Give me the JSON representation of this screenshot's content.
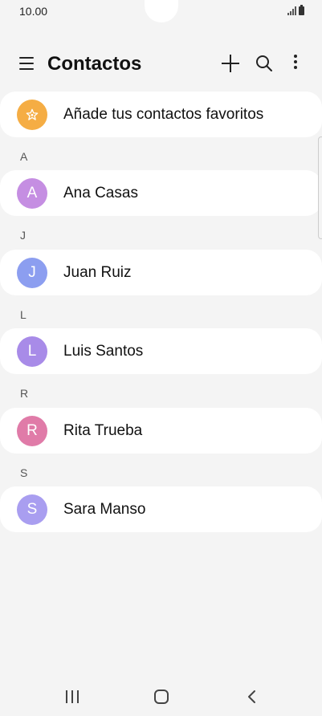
{
  "status_bar": {
    "time": "10.00",
    "icons": [
      "signal-icon",
      "battery-icon"
    ]
  },
  "app_bar": {
    "title": "Contactos",
    "icons": [
      "menu-icon",
      "add-icon",
      "search-icon",
      "more-icon"
    ]
  },
  "favorites": {
    "label": "Añade tus contactos favoritos",
    "icon": "star-icon",
    "color": "#f5ad44"
  },
  "sections": [
    {
      "letter": "A",
      "contact": {
        "initial": "A",
        "name": "Ana Casas",
        "color": "#c58ee2"
      }
    },
    {
      "letter": "J",
      "contact": {
        "initial": "J",
        "name": "Juan Ruiz",
        "color": "#8c9ef0"
      }
    },
    {
      "letter": "L",
      "contact": {
        "initial": "L",
        "name": "Luis Santos",
        "color": "#a88be8"
      }
    },
    {
      "letter": "R",
      "contact": {
        "initial": "R",
        "name": "Rita Trueba",
        "color": "#e07ba8"
      }
    },
    {
      "letter": "S",
      "contact": {
        "initial": "S",
        "name": "Sara Manso",
        "color": "#a99ef0"
      }
    }
  ],
  "nav_bar": {
    "icons": [
      "recent-apps-icon",
      "home-icon",
      "back-icon"
    ]
  }
}
